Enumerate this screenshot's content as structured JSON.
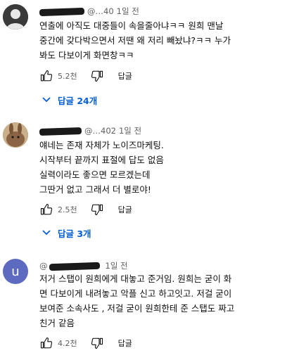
{
  "comments": [
    {
      "handle": "@…40",
      "time": "1일 전",
      "lines": [
        "연출에 아직도 대중들이 속을줄아냐ㅋㅋ 원희 맨날",
        "중간에 갖다박으면서 저땐 왜 저리 빼놨냐?ㅋㅋ 누가",
        "봐도 다보이게 화면창ㅋㅋ"
      ],
      "likes": "5.2천",
      "reply_label": "답글",
      "replies_label": "답글 24개",
      "avatar_color": "#2b2b2b"
    },
    {
      "handle": "@…402",
      "time": "1일 전",
      "lines": [
        "얘네는 존재 자체가 노이즈마케팅.",
        "시작부터 끝까지 표절에 답도 없음",
        "실력이라도 좋으면 모르겠는데",
        "그딴거 없고 그래서 더 별로야!"
      ],
      "likes": "2.5천",
      "reply_label": "답글",
      "replies_label": "답글 3개",
      "avatar_color": "#8a6e4b"
    },
    {
      "handle": "@",
      "time": "1일 전",
      "avatar_letter": "u",
      "lines": [
        "저거 스탭이 원희에게 대놓고 준거임. 원희는 굳이 화",
        "면 다보이게 내려놓고 악플 신고 하고잇고. 저걸 굳이",
        "보여준 소속사도 , 저걸 굳이 원희한테 준 스탭도 짜고",
        "친거 같음"
      ],
      "likes": "4.2천",
      "reply_label": "답글",
      "avatar_color": "#5c6bc0"
    }
  ],
  "colors": {
    "link_blue": "#065fd4",
    "meta_gray": "#606060",
    "text": "#0f0f0f"
  }
}
